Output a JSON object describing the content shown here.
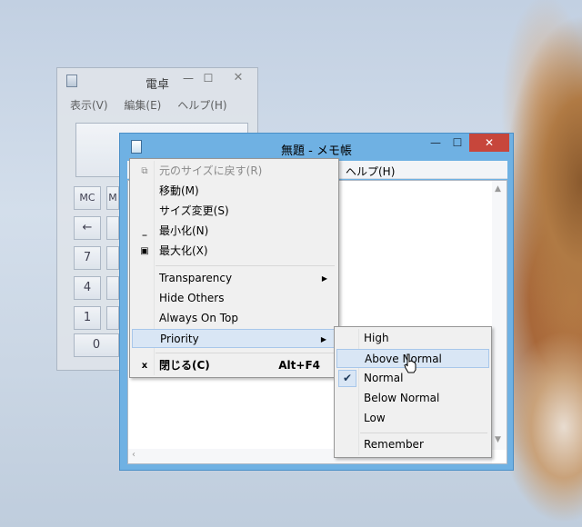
{
  "calculator": {
    "title": "電卓",
    "menu": [
      "表示(V)",
      "編集(E)",
      "ヘルプ(H)"
    ],
    "keys": {
      "mc": "MC",
      "m": "M",
      "back": "←",
      "k7": "7",
      "k4": "4",
      "k1": "1",
      "k0": "0"
    },
    "min_glyph": "—",
    "max_glyph": "☐",
    "close_glyph": "✕"
  },
  "notepad": {
    "title": "無題 - メモ帳",
    "help_menu": "ヘルプ(H)",
    "min_glyph": "—",
    "max_glyph": "☐",
    "close_glyph": "✕"
  },
  "system_menu": {
    "items": [
      {
        "label": "元のサイズに戻す(R)",
        "state": "disabled",
        "icon": "restore-icon"
      },
      {
        "label": "移動(M)",
        "icon": ""
      },
      {
        "label": "サイズ変更(S)",
        "icon": ""
      },
      {
        "label": "最小化(N)",
        "icon": "minimize-icon"
      },
      {
        "label": "最大化(X)",
        "icon": "maximize-icon"
      },
      {
        "label": "Transparency",
        "submenu": true
      },
      {
        "label": "Hide Others"
      },
      {
        "label": "Always On Top"
      },
      {
        "label": "Priority",
        "submenu": true,
        "state": "highlighted"
      },
      {
        "label": "閉じる(C)",
        "accelerator": "Alt+F4",
        "bold": true,
        "icon": "close-icon"
      }
    ]
  },
  "priority_submenu": {
    "items": [
      {
        "label": "High"
      },
      {
        "label": "Above Normal",
        "state": "hover"
      },
      {
        "label": "Normal",
        "checked": true
      },
      {
        "label": "Below Normal"
      },
      {
        "label": "Low"
      },
      {
        "label": "Remember"
      }
    ]
  },
  "colors": {
    "notepad_frame": "#6fb1e3",
    "close_button": "#c7463b",
    "menu_highlight": "#d9e6f5"
  }
}
